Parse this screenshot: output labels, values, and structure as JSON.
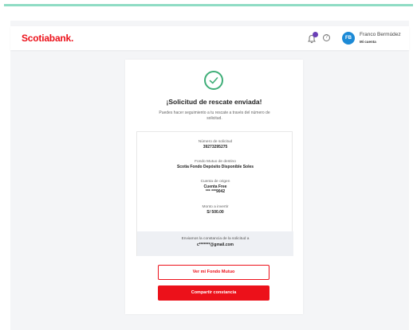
{
  "header": {
    "brand": "Scotiabank.",
    "user": {
      "initials": "FB",
      "name": "Franco Bermúdez",
      "subtitle": "Mi cuenta"
    },
    "help_glyph": "?",
    "icons": [
      "notification-icon",
      "help-icon"
    ]
  },
  "confirmation": {
    "title": "¡Solicitud de rescate enviada!",
    "description": "Puedes hacer seguimiento a tu rescate a través del número de solicitud.",
    "fields": [
      {
        "label": "Número de solicitud",
        "value": "39273295275"
      },
      {
        "label": "Fondo Mutuo de destino",
        "value": "Scotia Fondo Depósito Disponible Soles"
      },
      {
        "label": "Cuenta de origen",
        "value": "Cuenta Free",
        "extra": "*** ***9042"
      },
      {
        "label": "Monto a invertir",
        "value": "S/ 500.00"
      }
    ],
    "email_notice": "Enviamos la constancia de la solicitud a",
    "email": "c*******@gmail.com"
  },
  "actions": {
    "secondary_label": "Ver mi Fondo Mutuo",
    "primary_label": "Compartir constancia"
  },
  "colors": {
    "brand_red": "#ec111a",
    "success_green": "#3fae78",
    "avatar_blue": "#1c8ad6",
    "notification_purple": "#6a3fb6",
    "accent_teal": "#8fdcc4"
  }
}
